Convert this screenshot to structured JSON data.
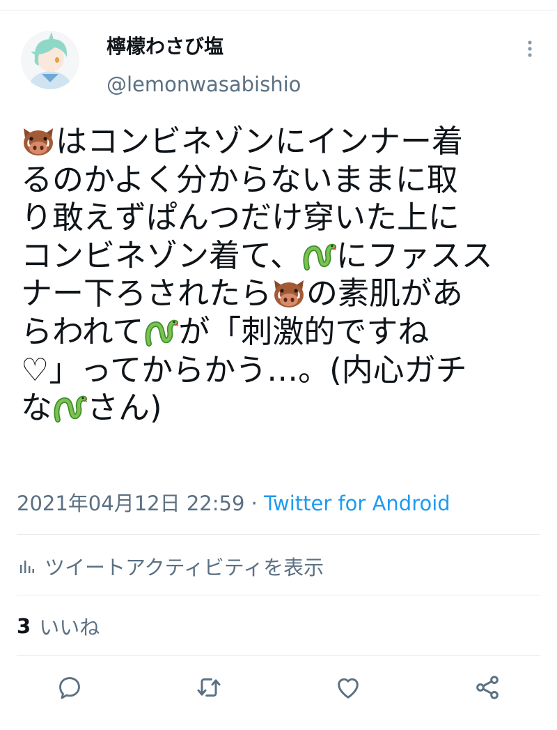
{
  "user": {
    "display_name": "檸檬わさび塩",
    "handle": "@lemonwasabishio",
    "avatar_icon": "avatar-illustration"
  },
  "tweet": {
    "lines": [
      [
        {
          "e": "boar-emoji"
        },
        {
          "t": "はコンビネゾンにインナー着"
        }
      ],
      [
        {
          "t": "るのかよく分からないままに取"
        }
      ],
      [
        {
          "t": "り敢えずぱんつだけ穿いた上に"
        }
      ],
      [
        {
          "t": "コンビネゾン着て、"
        },
        {
          "e": "snake-emoji"
        },
        {
          "t": "にファスス"
        }
      ],
      [
        {
          "t": "ナー下ろされたら"
        },
        {
          "e": "boar-emoji"
        },
        {
          "t": "の素肌があ"
        }
      ],
      [
        {
          "t": "らわれて"
        },
        {
          "e": "snake-emoji"
        },
        {
          "t": "が「刺激的ですね"
        }
      ],
      [
        {
          "t": "♡」ってからかう…。(内心ガチ"
        }
      ],
      [
        {
          "t": "な"
        },
        {
          "e": "snake-emoji"
        },
        {
          "t": "さん)"
        }
      ]
    ]
  },
  "meta": {
    "timestamp": "2021年04月12日 22:59",
    "separator": " · ",
    "source": "Twitter for Android"
  },
  "activity": {
    "label": "ツイートアクティビティを表示",
    "icon": "bar-chart-icon"
  },
  "likes": {
    "count": "3",
    "label": "いいね"
  },
  "actions": [
    {
      "name": "reply-button",
      "icon": "reply-icon"
    },
    {
      "name": "retweet-button",
      "icon": "retweet-icon"
    },
    {
      "name": "like-button",
      "icon": "heart-icon"
    },
    {
      "name": "share-button",
      "icon": "share-icon"
    }
  ],
  "colors": {
    "text": "#0f1419",
    "secondary": "#5b7083",
    "link": "#1d9bf0",
    "divider": "#e6ecf0"
  }
}
